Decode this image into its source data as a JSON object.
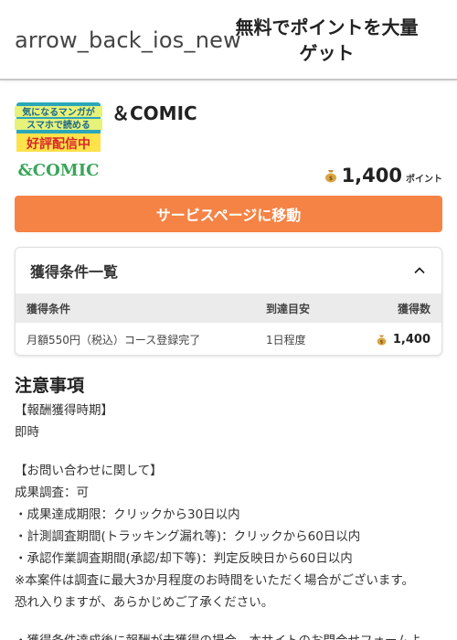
{
  "header": {
    "back_label": "arrow_back_ios_new",
    "title": "無料でポイントを大量ゲット"
  },
  "service": {
    "name": "＆COMIC",
    "thumbnail_lines": [
      "気になるマンガが",
      "スマホで読める",
      "好評配信中",
      "&COMIC"
    ],
    "points_value": "1,400",
    "points_unit": "ポイント",
    "cta_label": "サービスページに移動"
  },
  "conditions": {
    "title": "獲得条件一覧",
    "columns": [
      "獲得条件",
      "到達目安",
      "獲得数"
    ],
    "rows": [
      {
        "condition": "月額550円（税込）コース登録完了",
        "eta": "1日程度",
        "points": "1,400"
      }
    ]
  },
  "notes": {
    "title": "注意事項",
    "lines": [
      "【報酬獲得時期】",
      "即時",
      "",
      "【お問い合わせに関して】",
      "成果調査：可",
      "・成果達成期限：クリックから30日以内",
      "・計測調査期間(トラッキング漏れ等)：クリックから60日以内",
      "・承認作業調査期間(承認/却下等)：判定反映日から60日以内",
      "※本案件は調査に最大3か月程度のお時間をいただく場合がございます。",
      "恐れ入りますが、あらかじめご了承ください。",
      "",
      "・獲得条件達成後に報酬が未獲得の場合、本サイトのお問合せフォームよ"
    ]
  },
  "colors": {
    "accent": "#f58345",
    "table_header_bg": "#ebebeb",
    "coin_bag": "#d9a441"
  },
  "icons": [
    "arrow-back-icon",
    "coin-bag-icon",
    "chevron-up-icon"
  ]
}
